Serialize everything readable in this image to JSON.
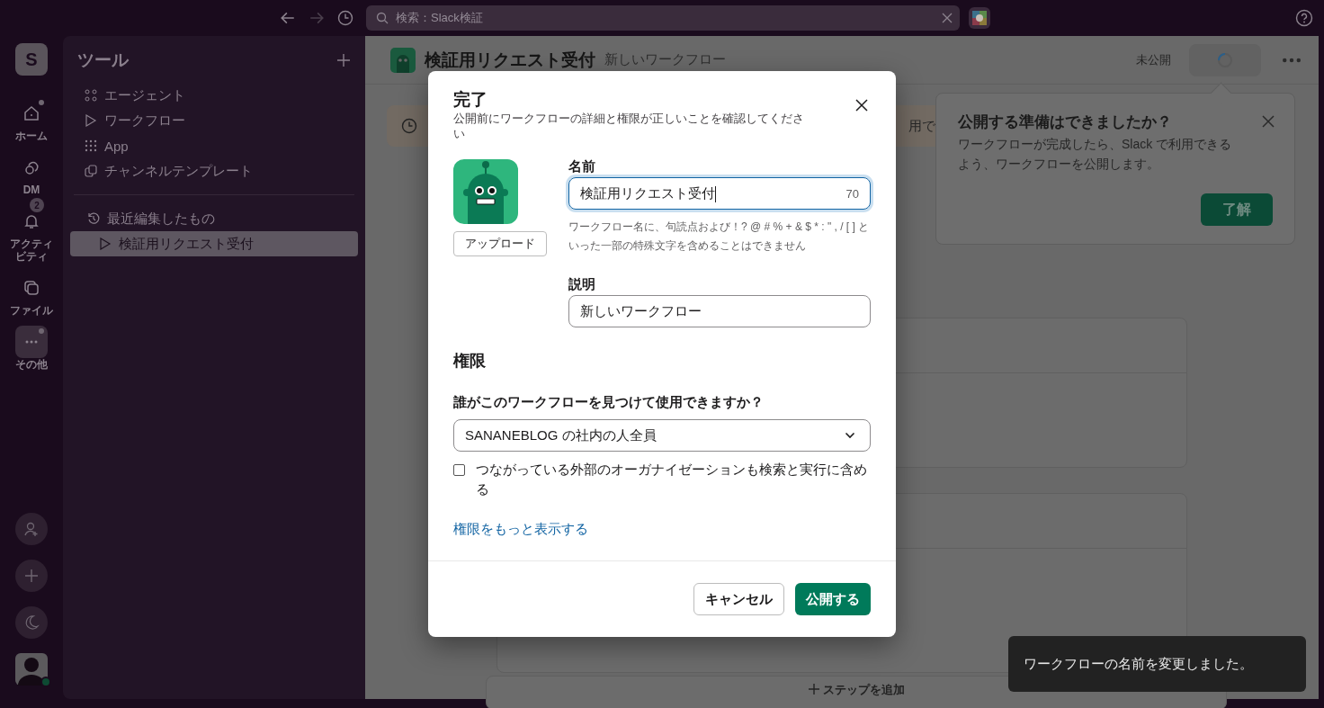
{
  "topbar": {
    "search": {
      "placeholder": "検索：Slack検証"
    }
  },
  "rail": {
    "workspace": "S",
    "items": [
      {
        "kind": "home",
        "label": "ホーム",
        "unread": true
      },
      {
        "kind": "dm",
        "label": "DM",
        "unread": false
      },
      {
        "kind": "activity",
        "label": "アクティビティ",
        "unread": false,
        "badge": "2"
      },
      {
        "kind": "files",
        "label": "ファイル",
        "unread": false
      },
      {
        "kind": "more",
        "label": "その他",
        "unread": true
      }
    ]
  },
  "sidebar": {
    "title": "ツール",
    "items": [
      {
        "kind": "agent",
        "label": "エージェント"
      },
      {
        "kind": "workflow",
        "label": "ワークフロー"
      },
      {
        "kind": "app",
        "label": "App"
      },
      {
        "kind": "template",
        "label": "チャンネルテンプレート"
      }
    ],
    "recent": {
      "title": "最近編集したもの",
      "items": [
        {
          "label": "検証用リクエスト受付",
          "selected": true
        }
      ]
    }
  },
  "header": {
    "title": "検証用リクエスト受付",
    "subtitle": "新しいワークフロー",
    "status": "未公開"
  },
  "banner": {
    "text": "用で"
  },
  "add_step": "ステップを追加",
  "popover": {
    "title": "公開する準備はできましたか？",
    "body": "ワークフローが完成したら、Slack で利用できるよう、ワークフローを公開します。",
    "button": "了解"
  },
  "modal": {
    "title": "完了",
    "subtitle": "公開前にワークフローの詳細と権限が正しいことを確認してください",
    "upload": "アップロード",
    "name": {
      "label": "名前",
      "value": "検証用リクエスト受付",
      "counter": "70",
      "focused": true
    },
    "name_hint": "ワークフロー名に、句読点および！? @ # % + & $ * : \" , / [ ] といった一部の特殊文字を含めることはできません",
    "description": {
      "label": "説明",
      "value": "新しいワークフロー",
      "focused": false
    },
    "permissions": {
      "heading": "権限",
      "question": "誰がこのワークフローを見つけて使用できますか？",
      "select": "SANANEBLOG の社内の人全員",
      "external": {
        "label": "つながっている外部のオーガナイゼーションも検索と実行に含める",
        "checked": false
      },
      "more_link": "権限をもっと表示する"
    },
    "buttons": [
      {
        "kind": "secondary",
        "label": "キャンセル"
      },
      {
        "kind": "primary",
        "label": "公開する"
      }
    ]
  },
  "toast": "ワークフローの名前を変更しました。"
}
